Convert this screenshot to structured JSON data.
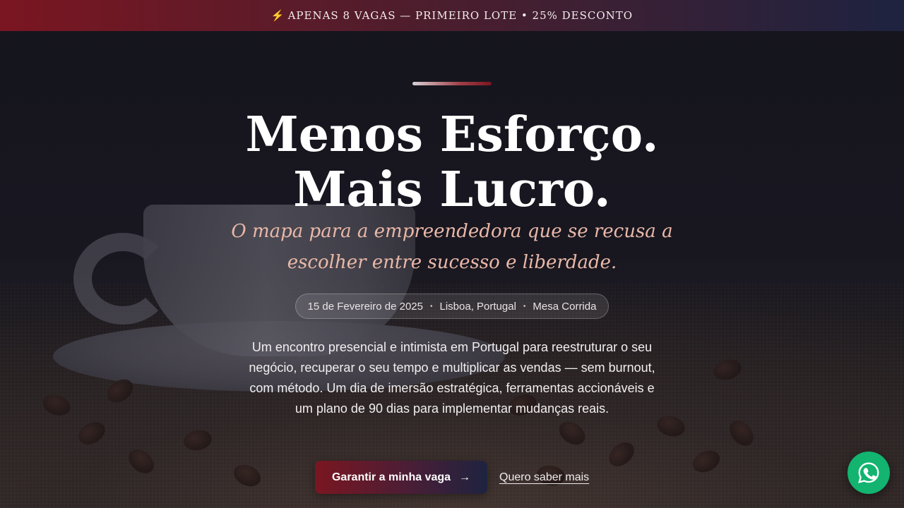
{
  "banner": {
    "icon": "lightning-icon",
    "icon_glyph": "⚡",
    "text": "APENAS 8 VAGAS — PRIMEIRO LOTE • 25% DESCONTO"
  },
  "hero": {
    "headline_line1": "Menos Esforço.",
    "headline_line2": "Mais Lucro.",
    "subheadline_line1": "O mapa para a empreendedora que se recusa a",
    "subheadline_line2": "escolher entre sucesso e liberdade.",
    "meta": {
      "date": "15 de Fevereiro de 2025",
      "location": "Lisboa, Portugal",
      "format": "Mesa Corrida",
      "separator": "•"
    },
    "description": "Um encontro presencial e intimista em Portugal para reestruturar o seu negócio, recuperar o seu tempo e multiplicar as vendas — sem burnout, com método. Um dia de imersão estratégica, ferramentas accionáveis e um plano de 90 dias para implementar mudanças reais.",
    "cta_primary": {
      "label": "Garantir a minha vaga",
      "icon": "arrow-right-icon",
      "icon_glyph": "→"
    },
    "cta_secondary": "Quero saber mais"
  },
  "floating": {
    "whatsapp_icon": "whatsapp-icon"
  },
  "colors": {
    "brand_red": "#7a1621",
    "brand_navy": "#1e2340",
    "accent_peach": "#e9b8a8",
    "whatsapp_green": "#12b470"
  }
}
